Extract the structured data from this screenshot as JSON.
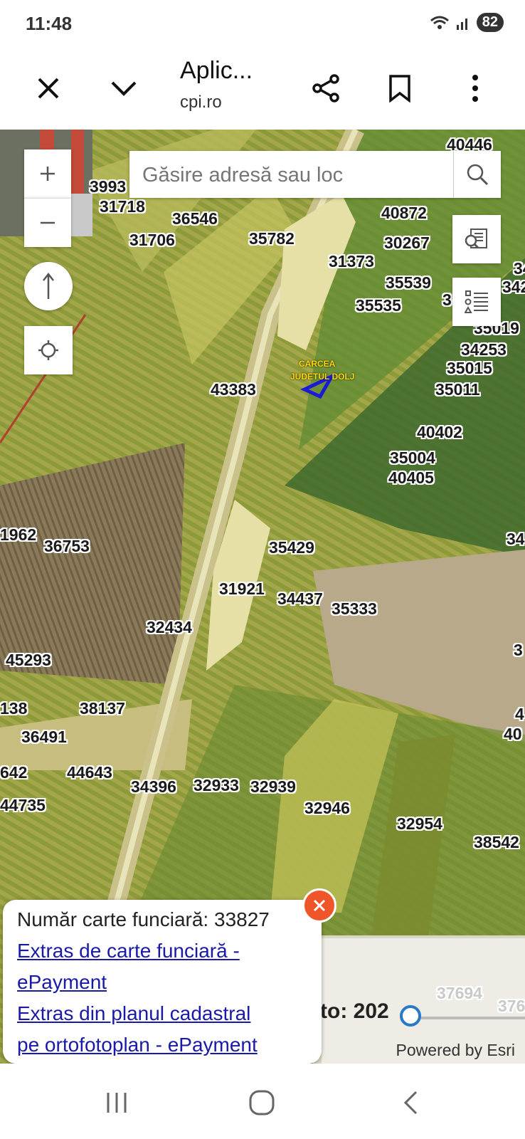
{
  "status": {
    "time": "11:48",
    "battery": "82"
  },
  "toolbar": {
    "title": "Aplic...",
    "url": "cpi.ro"
  },
  "search": {
    "placeholder": "Găsire adresă sau loc"
  },
  "map": {
    "locality_labels": [
      "CARCEA",
      "JUDETUL DOLJ"
    ],
    "parcels": [
      "40446",
      "3993",
      "31718",
      "36546",
      "31706",
      "35782",
      "40872",
      "30267",
      "31373",
      "35539",
      "35535",
      "3",
      "34",
      "342",
      "35019",
      "34253",
      "35015",
      "35011",
      "43383",
      "40402",
      "35004",
      "40405",
      "1962",
      "36753",
      "35429",
      "34",
      "31921",
      "34437",
      "35333",
      "32434",
      "45293",
      "3",
      "138",
      "38137",
      "4",
      "36491",
      "40",
      "642",
      "44643",
      "34396",
      "32933",
      "32939",
      "44735",
      "32946",
      "32954",
      "38542",
      "37694",
      "376"
    ]
  },
  "popup": {
    "cf_label": "Număr carte funciară: 33827",
    "link1_line1": "Extras de carte funciară -",
    "link1_line2": "ePayment",
    "link2_line1": "Extras din planul cadastral",
    "link2_line2": "pe ortofotoplan - ePayment"
  },
  "slider": {
    "label": "to: 202"
  },
  "attribution": "Powered by Esri",
  "icons": {
    "close": "close-icon",
    "chevron": "chevron-down-icon",
    "share": "share-icon",
    "bookmark": "bookmark-icon",
    "more": "more-vert-icon",
    "search": "search-icon",
    "zoom_in": "plus-icon",
    "zoom_out": "minus-icon",
    "compass": "north-arrow-icon",
    "locate": "locate-icon",
    "identify": "identify-icon",
    "legend": "legend-icon"
  }
}
